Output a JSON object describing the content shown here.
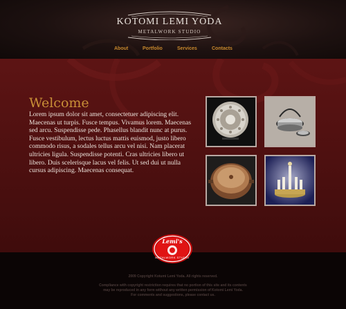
{
  "brand": {
    "name": "Kotomi Lemi Yoda",
    "subtitle": "Metalwork Studio"
  },
  "nav": {
    "items": [
      {
        "label": "About"
      },
      {
        "label": "Portfolio"
      },
      {
        "label": "Services"
      },
      {
        "label": "Contacts"
      }
    ]
  },
  "main": {
    "heading": "Welcome",
    "body": "Lorem ipsum dolor sit amet, consectetuer adipiscing elit. Maecenas ut turpis. Fusce tempus. Vivamus lorem. Maecenas sed arcu. Suspendisse pede. Phasellus blandit nunc at purus. Fusce vestibulum, lectus luctus mattis euismod, justo libero commodo risus, a sodales tellus arcu vel nisi. Nam placerat ultricies ligula. Suspendisse potenti. Cras ultricies libero ut libero. Duis scelerisque lacus vel felis. Ut sed dui ut nulla cursus adipiscing. Maecenas consequat."
  },
  "gallery": {
    "items": [
      {
        "name": "decorative-plate-image"
      },
      {
        "name": "silver-kettle-image"
      },
      {
        "name": "copper-pot-image"
      },
      {
        "name": "candle-holder-image"
      }
    ]
  },
  "footer": {
    "badge_top": "Lemi's",
    "badge_bottom": "METALWORK STUDIO",
    "copyright": "2009 Copyright Kotumi Lemi Yoda. All rights reserved.",
    "legal_line1": "Compliance with copyright restriction requires that no portion of this site and its contents",
    "legal_line2": "may be reproduced in any form without any written permission of Kotomi Lemi Yoda.",
    "legal_line3": "For comments and suggestions, please contact us."
  },
  "colors": {
    "accent": "#c9892d",
    "main_bg": "#5d1414",
    "badge_red": "#e01010"
  }
}
